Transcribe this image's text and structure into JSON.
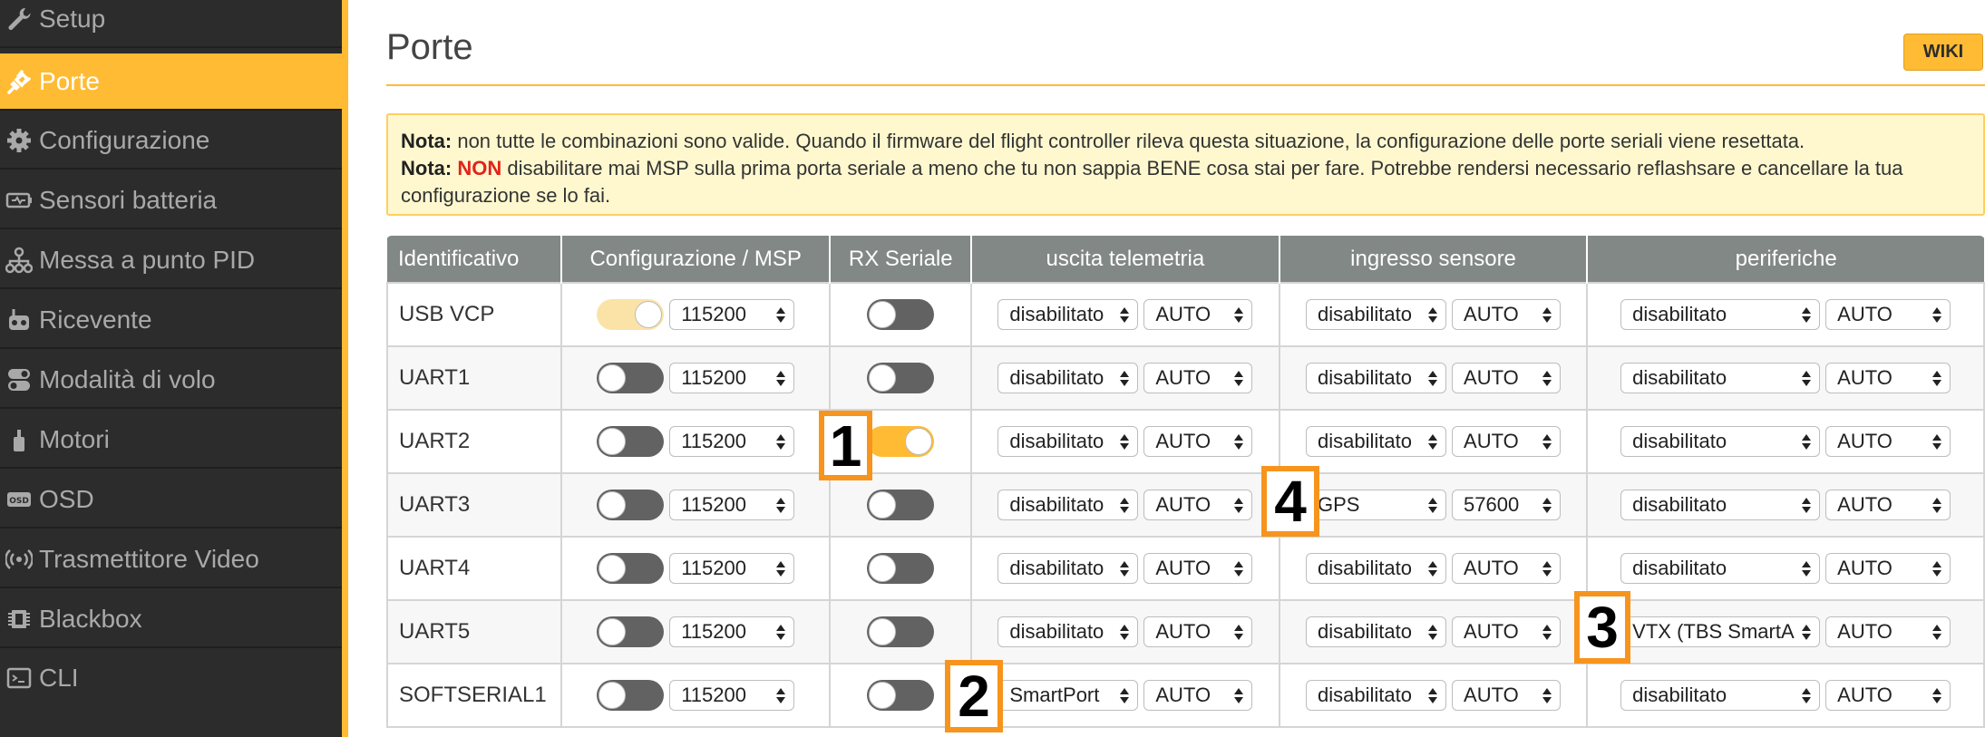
{
  "sidebar": {
    "items": [
      {
        "label": "Setup",
        "icon": "wrench-icon",
        "active": false
      },
      {
        "label": "Porte",
        "icon": "plug-icon",
        "active": true
      },
      {
        "label": "Configurazione",
        "icon": "gear-icon",
        "active": false
      },
      {
        "label": "Sensori batteria",
        "icon": "battery-icon",
        "active": false
      },
      {
        "label": "Messa a punto PID",
        "icon": "sitemap-icon",
        "active": false
      },
      {
        "label": "Ricevente",
        "icon": "receiver-icon",
        "active": false
      },
      {
        "label": "Modalità di volo",
        "icon": "toggles-icon",
        "active": false
      },
      {
        "label": "Motori",
        "icon": "motor-icon",
        "active": false
      },
      {
        "label": "OSD",
        "icon": "osd-icon",
        "active": false
      },
      {
        "label": "Trasmettitore Video",
        "icon": "antenna-icon",
        "active": false
      },
      {
        "label": "Blackbox",
        "icon": "blackbox-icon",
        "active": false
      },
      {
        "label": "CLI",
        "icon": "terminal-icon",
        "active": false
      }
    ]
  },
  "header": {
    "title": "Porte",
    "wiki_label": "WIKI"
  },
  "note": {
    "line1_bold": "Nota:",
    "line1_text": " non tutte le combinazioni sono valide. Quando il firmware del flight controller rileva questa situazione, la configurazione delle porte seriali viene resettata.",
    "line2_bold": "Nota:",
    "line2_non": "NON",
    "line2_text": " disabilitare mai MSP sulla prima porta seriale a meno che tu non sappia BENE cosa stai per fare. Potrebbe rendersi necessario reflashsare e cancellare la tua configurazione se lo fai."
  },
  "table": {
    "headers": [
      "Identificativo",
      "Configurazione / MSP",
      "RX Seriale",
      "uscita telemetria",
      "ingresso sensore",
      "periferiche"
    ],
    "rows": [
      {
        "id": "USB VCP",
        "msp": "on-light",
        "msp_baud": "115200",
        "rx": "off",
        "tel": "disabilitato",
        "tel_baud": "AUTO",
        "sen": "disabilitato",
        "sen_baud": "AUTO",
        "per": "disabilitato",
        "per_baud": "AUTO"
      },
      {
        "id": "UART1",
        "msp": "off",
        "msp_baud": "115200",
        "rx": "off",
        "tel": "disabilitato",
        "tel_baud": "AUTO",
        "sen": "disabilitato",
        "sen_baud": "AUTO",
        "per": "disabilitato",
        "per_baud": "AUTO"
      },
      {
        "id": "UART2",
        "msp": "off",
        "msp_baud": "115200",
        "rx": "on",
        "tel": "disabilitato",
        "tel_baud": "AUTO",
        "sen": "disabilitato",
        "sen_baud": "AUTO",
        "per": "disabilitato",
        "per_baud": "AUTO"
      },
      {
        "id": "UART3",
        "msp": "off",
        "msp_baud": "115200",
        "rx": "off",
        "tel": "disabilitato",
        "tel_baud": "AUTO",
        "sen": "GPS",
        "sen_baud": "57600",
        "per": "disabilitato",
        "per_baud": "AUTO"
      },
      {
        "id": "UART4",
        "msp": "off",
        "msp_baud": "115200",
        "rx": "off",
        "tel": "disabilitato",
        "tel_baud": "AUTO",
        "sen": "disabilitato",
        "sen_baud": "AUTO",
        "per": "disabilitato",
        "per_baud": "AUTO"
      },
      {
        "id": "UART5",
        "msp": "off",
        "msp_baud": "115200",
        "rx": "off",
        "tel": "disabilitato",
        "tel_baud": "AUTO",
        "sen": "disabilitato",
        "sen_baud": "AUTO",
        "per": "VTX (TBS SmartA",
        "per_baud": "AUTO"
      },
      {
        "id": "SOFTSERIAL1",
        "msp": "off",
        "msp_baud": "115200",
        "rx": "off",
        "tel": "SmartPort",
        "tel_baud": "AUTO",
        "sen": "disabilitato",
        "sen_baud": "AUTO",
        "per": "disabilitato",
        "per_baud": "AUTO"
      }
    ]
  },
  "markers": [
    "1",
    "2",
    "3",
    "4"
  ],
  "colors": {
    "accent": "#ffbb33",
    "sidebar": "#2c2c2c",
    "marker_border": "#f7941d",
    "warning_red": "#e2231a"
  }
}
